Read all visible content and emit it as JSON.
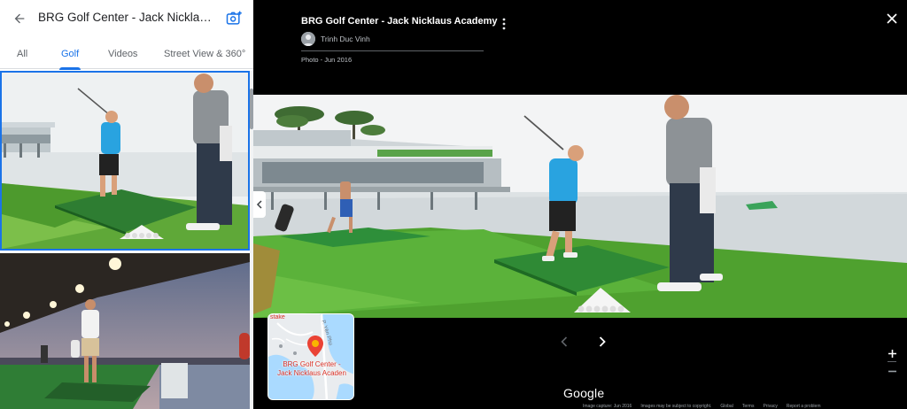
{
  "left_panel": {
    "title": "BRG Golf Center - Jack Nicklaus ...",
    "tabs": [
      {
        "label": "All",
        "active": false
      },
      {
        "label": "Golf",
        "active": true
      },
      {
        "label": "Videos",
        "active": false
      },
      {
        "label": "Street View & 360°",
        "active": false
      }
    ]
  },
  "viewer": {
    "title": "BRG Golf Center - Jack Nicklaus Academy",
    "author": "Trinh Duc Vinh",
    "date": "Photo - Jun 2016",
    "map": {
      "corner_text": "stake",
      "street_text": "P. Yên Phụ",
      "label_line1": "BRG Golf Center -",
      "label_line2": "Jack Nicklaus Acaden"
    },
    "brand": "Google",
    "footer_links": [
      "Image capture: Jun 2016",
      "Images may be subject to copyright.",
      "Global",
      "Terms",
      "Privacy",
      "Report a problem"
    ]
  },
  "colors": {
    "accent": "#1a73e8",
    "pin": "#ea4335"
  }
}
